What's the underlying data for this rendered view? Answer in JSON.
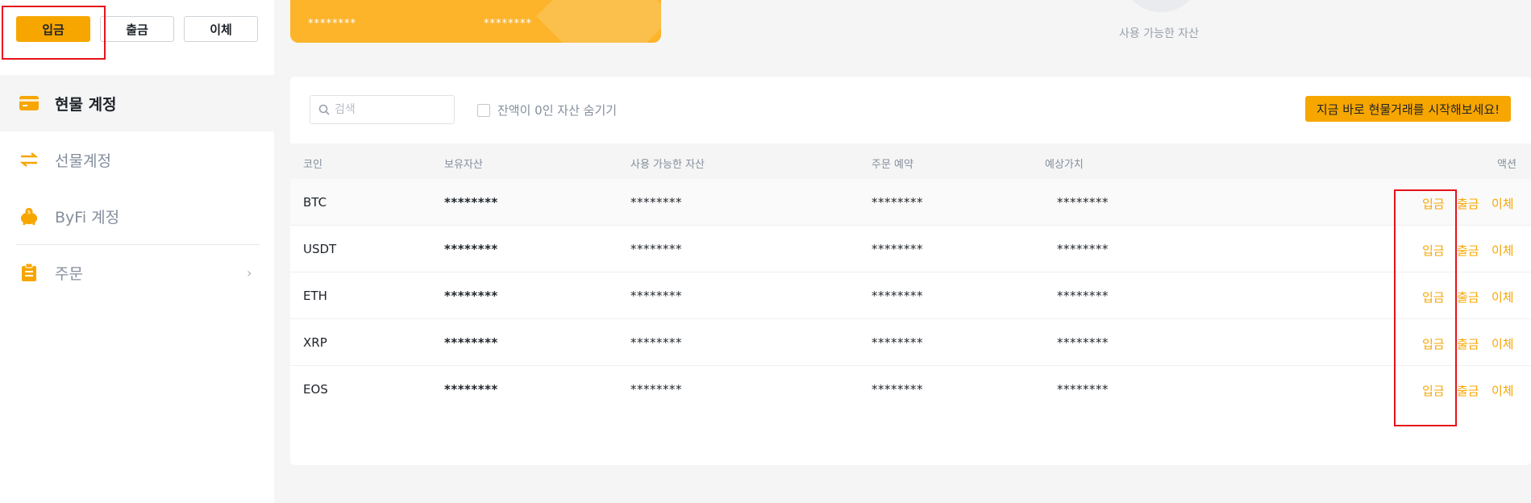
{
  "top_actions": {
    "deposit": "입금",
    "withdraw": "출금",
    "transfer": "이체"
  },
  "sidebar": {
    "items": [
      {
        "label": "현물 계정",
        "icon": "wallet-icon",
        "active": true
      },
      {
        "label": "선물계정",
        "icon": "exchange-arrows-icon",
        "active": false
      },
      {
        "label": "ByFi 계정",
        "icon": "piggy-bank-icon",
        "active": false
      },
      {
        "label": "주문",
        "icon": "clipboard-icon",
        "active": false,
        "chevron": "›"
      }
    ]
  },
  "card": {
    "mask_1": "********",
    "mask_2": "********"
  },
  "available_label": "사용 가능한 자산",
  "toolbar": {
    "search_placeholder": "검색",
    "hide_zero_label": "잔액이 0인 자산 숨기기",
    "cta_label": "지금 바로 현물거래를 시작해보세요!"
  },
  "table": {
    "headers": [
      "코인",
      "보유자산",
      "사용 가능한 자산",
      "주문 예약",
      "예상가치",
      "액션"
    ],
    "rows": [
      {
        "coin": "BTC",
        "holdings": "********",
        "available": "********",
        "order": "********",
        "estimated": "********"
      },
      {
        "coin": "USDT",
        "holdings": "********",
        "available": "********",
        "order": "********",
        "estimated": "********"
      },
      {
        "coin": "ETH",
        "holdings": "********",
        "available": "********",
        "order": "********",
        "estimated": "********"
      },
      {
        "coin": "XRP",
        "holdings": "********",
        "available": "********",
        "order": "********",
        "estimated": "********"
      },
      {
        "coin": "EOS",
        "holdings": "********",
        "available": "********",
        "order": "********",
        "estimated": "********"
      }
    ],
    "actions": {
      "deposit": "입금",
      "withdraw": "출금",
      "transfer": "이체"
    }
  },
  "colors": {
    "accent": "#f7a600",
    "highlight": "#e6121a",
    "muted": "#848e9c"
  }
}
